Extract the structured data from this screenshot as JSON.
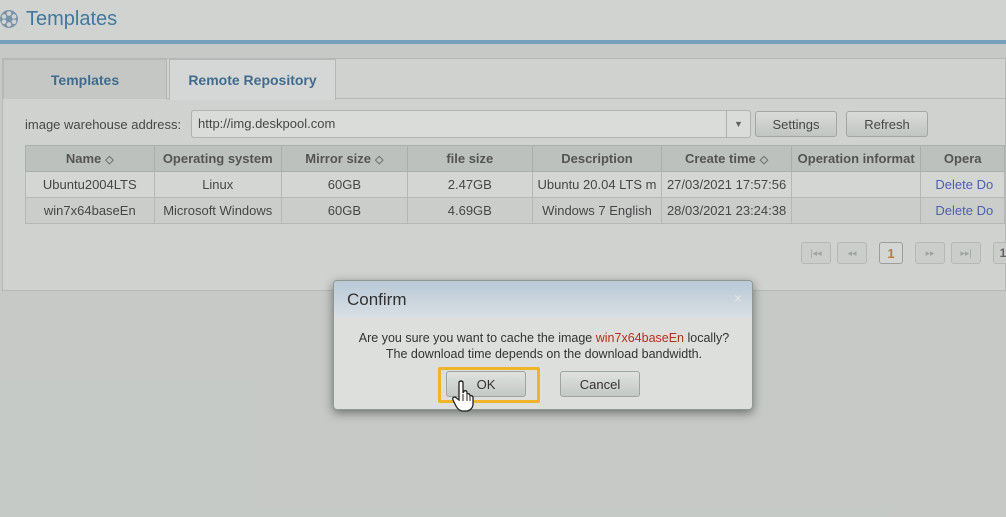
{
  "header": {
    "title": "Templates",
    "icon": "film-reel-icon",
    "accent": "#2d6e9c"
  },
  "tabs": [
    {
      "label": "Templates",
      "active": false
    },
    {
      "label": "Remote Repository",
      "active": true
    }
  ],
  "toolbar": {
    "address_label": "image warehouse address:",
    "address_value": "http://img.deskpool.com",
    "settings_label": "Settings",
    "refresh_label": "Refresh"
  },
  "table": {
    "columns": [
      "Name",
      "Operating system",
      "Mirror size",
      "file size",
      "Description",
      "Create time",
      "Operation informat",
      "Opera"
    ],
    "rows": [
      {
        "name": "Ubuntu2004LTS",
        "os": "Linux",
        "mirror_size": "60GB",
        "file_size": "2.47GB",
        "description": "Ubuntu 20.04 LTS m",
        "create_time": "27/03/2021 17:57:56",
        "operation_info": "",
        "delete_label": "Delete",
        "download_label": "Do"
      },
      {
        "name": "win7x64baseEn",
        "os": "Microsoft Windows",
        "mirror_size": "60GB",
        "file_size": "4.69GB",
        "description": "Windows 7 English",
        "create_time": "28/03/2021 23:24:38",
        "operation_info": "",
        "delete_label": "Delete",
        "download_label": "Do"
      }
    ]
  },
  "pager": {
    "first": "|◂◂",
    "prev": "◂◂",
    "current": "1",
    "next": "▸▸",
    "last": "▸▸|",
    "total": "1"
  },
  "dialog": {
    "title": "Confirm",
    "close": "×",
    "message_pre": "Are you sure you want to cache the image ",
    "message_image": "win7x64baseEn",
    "message_post": " locally?",
    "message_line2": "The download time depends on the download bandwidth.",
    "ok_label": "OK",
    "cancel_label": "Cancel"
  }
}
